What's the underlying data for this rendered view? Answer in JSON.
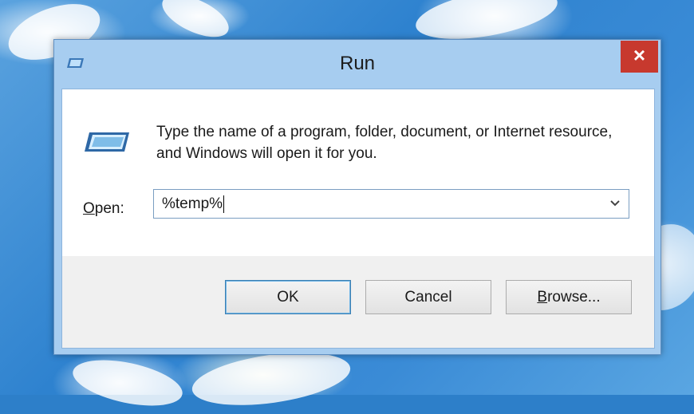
{
  "window": {
    "title": "Run",
    "close_label": "×"
  },
  "dialog": {
    "prompt": "Type the name of a program, folder, document, or Internet resource, and Windows will open it for you.",
    "open_label_underlined": "O",
    "open_label_rest": "pen:",
    "open_value": "%temp%"
  },
  "buttons": {
    "ok": "OK",
    "cancel": "Cancel",
    "browse_underlined": "B",
    "browse_rest": "rowse..."
  },
  "icons": {
    "title_icon": "run-icon",
    "dialog_icon": "run-icon",
    "dropdown": "chevron-down-icon"
  },
  "colors": {
    "close_button": "#c7392e",
    "window_frame": "#a7cdf0"
  }
}
